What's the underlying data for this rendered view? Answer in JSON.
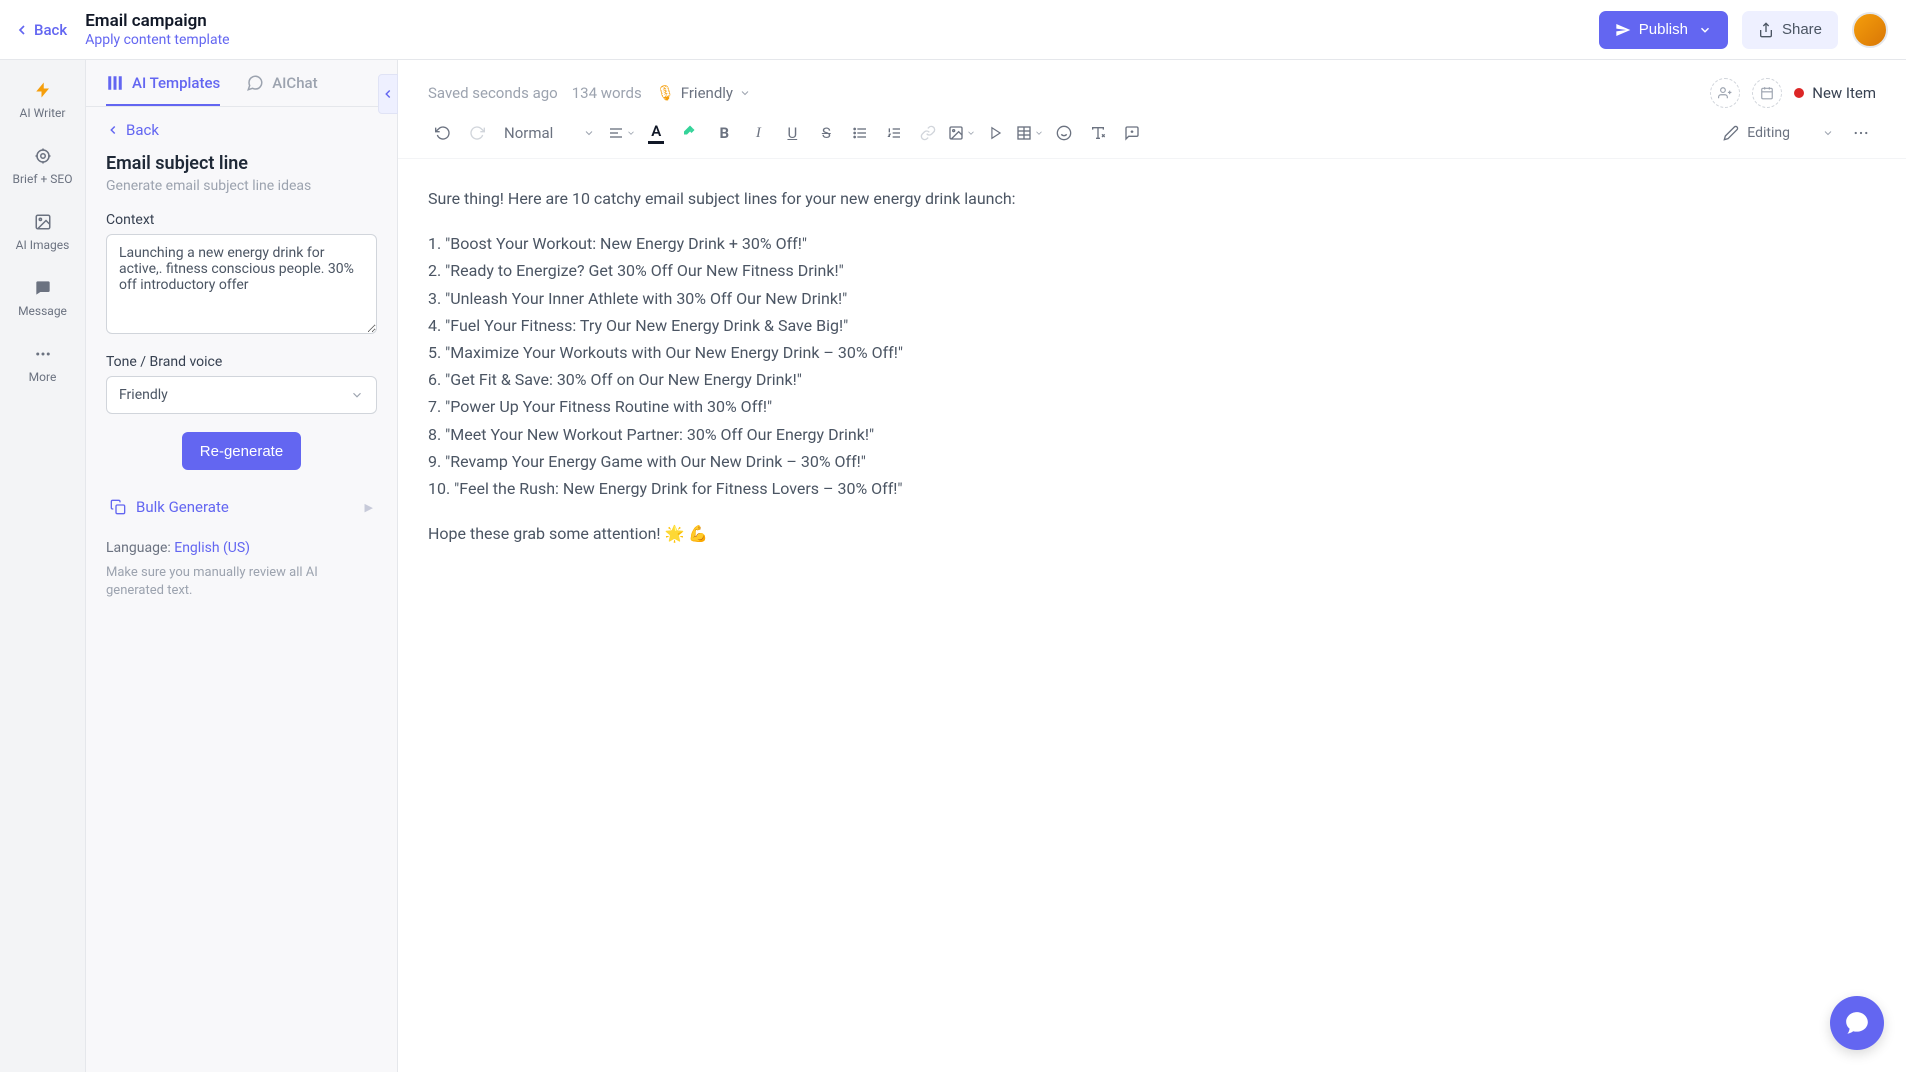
{
  "header": {
    "back": "Back",
    "title": "Email campaign",
    "subtitle": "Apply content template",
    "publish": "Publish",
    "share": "Share"
  },
  "rail": {
    "items": [
      {
        "label": "AI Writer"
      },
      {
        "label": "Brief + SEO"
      },
      {
        "label": "AI Images"
      },
      {
        "label": "Message"
      },
      {
        "label": "More"
      }
    ]
  },
  "panel": {
    "tabs": {
      "templates": "AI Templates",
      "chat": "AIChat"
    },
    "back": "Back",
    "title": "Email subject line",
    "subtitle": "Generate email subject line ideas",
    "context_label": "Context",
    "context_value": "Launching a new energy drink for active,. fitness conscious people. 30% off introductory offer",
    "tone_label": "Tone / Brand voice",
    "tone_value": "Friendly",
    "regenerate": "Re-generate",
    "bulk": "Bulk Generate",
    "language_label": "Language: ",
    "language_value": "English (US)",
    "warning": "Make sure you manually review all AI generated text."
  },
  "status": {
    "saved": "Saved seconds ago",
    "words": "134 words",
    "tone": "Friendly",
    "new_item": "New Item"
  },
  "toolbar": {
    "style": "Normal",
    "mode": "Editing"
  },
  "doc": {
    "intro": "Sure thing! Here are 10 catchy email subject lines for your new energy drink launch:",
    "lines": [
      "1. \"Boost Your Workout: New Energy Drink + 30% Off!\"",
      "2. \"Ready to Energize? Get 30% Off Our New Fitness Drink!\"",
      "3. \"Unleash Your Inner Athlete with 30% Off Our New Drink!\"",
      "4. \"Fuel Your Fitness: Try Our New Energy Drink & Save Big!\"",
      "5. \"Maximize Your Workouts with Our New Energy Drink – 30% Off!\"",
      "6. \"Get Fit & Save: 30% Off on Our New Energy Drink!\"",
      "7. \"Power Up Your Fitness Routine with 30% Off!\"",
      "8. \"Meet Your New Workout Partner: 30% Off Our Energy Drink!\"",
      "9. \"Revamp Your Energy Game with Our New Drink – 30% Off!\"",
      "10. \"Feel the Rush: New Energy Drink for Fitness Lovers – 30% Off!\""
    ],
    "outro": "Hope these grab some attention! 🌟 💪"
  }
}
